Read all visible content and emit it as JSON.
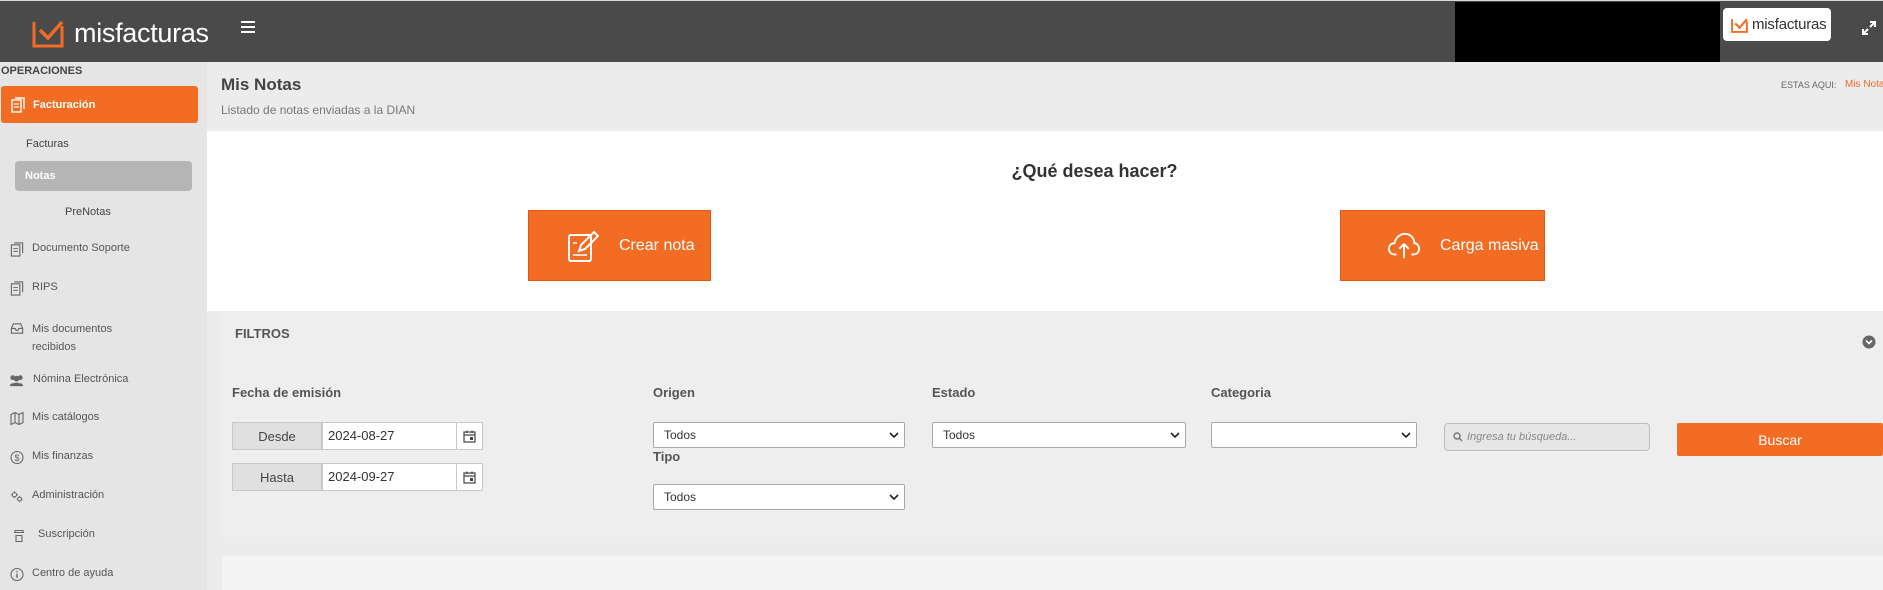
{
  "app": {
    "logo_text": "misfacturas",
    "badge_text": "misfacturas",
    "accent_color": "#f26c24"
  },
  "sidebar": {
    "section_label": "OPERACIONES",
    "active_item": "Facturación",
    "sub_items": [
      "Facturas",
      "Notas",
      "PreNotas"
    ],
    "items": [
      {
        "label": "Documento Soporte",
        "icon": "document-icon"
      },
      {
        "label": "RIPS",
        "icon": "document-icon"
      },
      {
        "label": "Mis documentos recibidos",
        "icon": "inbox-icon"
      },
      {
        "label": "Nómina Electrónica",
        "icon": "users-icon"
      },
      {
        "label": "Mis catálogos",
        "icon": "map-icon"
      },
      {
        "label": "Mis finanzas",
        "icon": "dollar-icon"
      },
      {
        "label": "Administración",
        "icon": "settings-icon"
      },
      {
        "label": "Suscripción",
        "icon": "hand-icon"
      },
      {
        "label": "Centro de ayuda",
        "icon": "info-icon"
      }
    ]
  },
  "header": {
    "title": "Mis Notas",
    "subtitle": "Listado de notas enviadas a la DIAN",
    "breadcrumb_label": "ESTAS AQUI:",
    "breadcrumb_current": "Mis Notas"
  },
  "actions": {
    "question": "¿Qué desea hacer?",
    "create_label": "Crear nota",
    "bulk_label": "Carga masiva"
  },
  "filters": {
    "title": "FILTROS",
    "fecha_label": "Fecha de emisión",
    "desde_label": "Desde",
    "desde_value": "2024-08-27",
    "hasta_label": "Hasta",
    "hasta_value": "2024-09-27",
    "origen_label": "Origen",
    "origen_value": "Todos",
    "tipo_label": "Tipo",
    "tipo_value": "Todos",
    "estado_label": "Estado",
    "estado_value": "Todos",
    "categoria_label": "Categoria",
    "categoria_value": "",
    "search_placeholder": "Ingresa tu búsqueda...",
    "search_button": "Buscar"
  }
}
